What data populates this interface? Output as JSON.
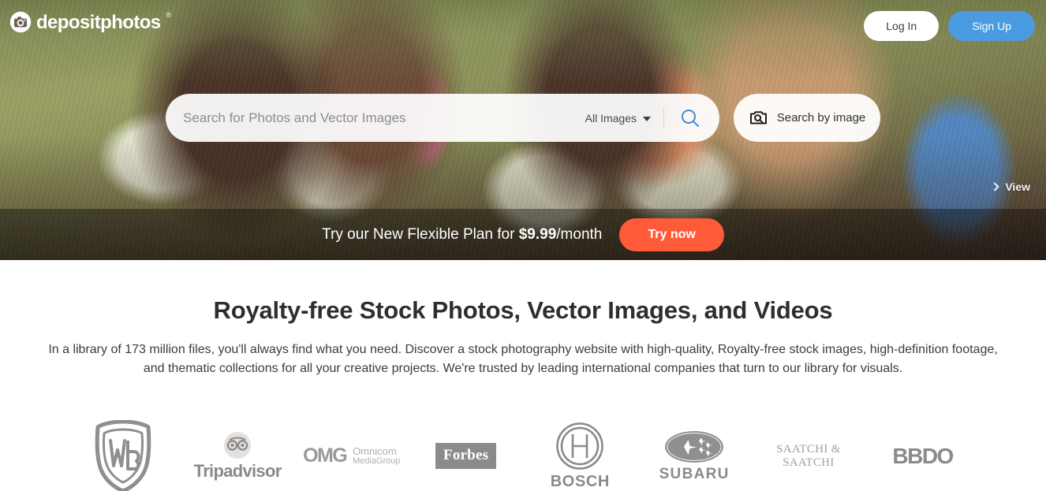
{
  "brand": {
    "name": "depositphotos",
    "registered_mark": "®",
    "icon": "camera-icon"
  },
  "header": {
    "login_label": "Log In",
    "signup_label": "Sign Up",
    "signup_color": "#4a9be0"
  },
  "search": {
    "placeholder": "Search for Photos and Vector Images",
    "value": "",
    "filter_selected": "All Images",
    "filter_options": [
      "All Images"
    ],
    "search_icon": "magnifier-icon",
    "search_icon_color": "#3d8fd6",
    "by_image_label": "Search by image",
    "by_image_icon": "camera-search-icon"
  },
  "hero": {
    "view_label": "View",
    "view_icon": "chevron-right-icon"
  },
  "promo": {
    "text_before": "Try our New Flexible Plan for ",
    "price": "$9.99",
    "text_after": "/month",
    "cta_label": "Try now",
    "cta_color": "#ff5b39"
  },
  "main": {
    "headline": "Royalty-free Stock Photos, Vector Images, and Videos",
    "subcopy": "In a library of 173 million files, you'll always find what you need. Discover a stock photography website with high-quality, Royalty-free stock images, high-definition footage, and thematic collections for all your creative projects. We're trusted by leading international companies that turn to our library for visuals."
  },
  "clients": [
    {
      "name": "Warner Bros",
      "mark": "WB"
    },
    {
      "name": "Tripadvisor",
      "mark": "Tripadvisor"
    },
    {
      "name": "Omnicom Media Group",
      "mark": "OMG",
      "line1": "Omnicom",
      "line2": "MediaGroup"
    },
    {
      "name": "Forbes",
      "mark": "Forbes"
    },
    {
      "name": "Bosch",
      "mark": "BOSCH"
    },
    {
      "name": "Subaru",
      "mark": "SUBARU"
    },
    {
      "name": "Saatchi & Saatchi",
      "mark": "SAATCHI & SAATCHI"
    },
    {
      "name": "BBDO",
      "mark": "BBDO"
    }
  ]
}
